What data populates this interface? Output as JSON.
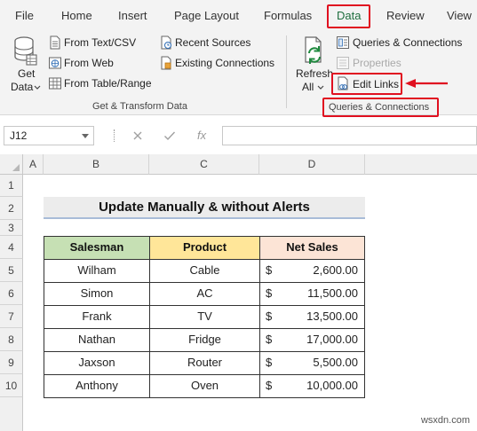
{
  "menu": {
    "tabs": [
      "File",
      "Home",
      "Insert",
      "Page Layout",
      "Formulas",
      "Data",
      "Review",
      "View"
    ],
    "active_tab": "Data"
  },
  "ribbon": {
    "get_data": {
      "line1": "Get",
      "line2": "Data"
    },
    "from_text_csv": "From Text/CSV",
    "from_web": "From Web",
    "from_table_range": "From Table/Range",
    "recent_sources": "Recent Sources",
    "existing_connections": "Existing Connections",
    "group1_label": "Get & Transform Data",
    "refresh": {
      "line1": "Refresh",
      "line2": "All"
    },
    "queries_connections": "Queries & Connections",
    "properties": "Properties",
    "edit_links": "Edit Links",
    "group2_label": "Queries & Connections"
  },
  "formula_bar": {
    "name_box": "J12",
    "fx": "fx",
    "formula": ""
  },
  "sheet": {
    "columns": [
      "A",
      "B",
      "C",
      "D"
    ],
    "rows": [
      "1",
      "2",
      "3",
      "4",
      "5",
      "6",
      "7",
      "8",
      "9",
      "10"
    ],
    "title": "Update Manually & without Alerts",
    "table_headers": [
      "Salesman",
      "Product",
      "Net Sales"
    ],
    "header_colors": [
      "#c6e0b4",
      "#ffe699",
      "#fce4d6"
    ],
    "currency_symbol": "$",
    "records": [
      {
        "salesman": "Wilham",
        "product": "Cable",
        "net_sales": "2,600.00"
      },
      {
        "salesman": "Simon",
        "product": "AC",
        "net_sales": "11,500.00"
      },
      {
        "salesman": "Frank",
        "product": "TV",
        "net_sales": "13,500.00"
      },
      {
        "salesman": "Nathan",
        "product": "Fridge",
        "net_sales": "17,000.00"
      },
      {
        "salesman": "Jaxson",
        "product": "Router",
        "net_sales": "5,500.00"
      },
      {
        "salesman": "Anthony",
        "product": "Oven",
        "net_sales": "10,000.00"
      }
    ]
  },
  "watermark": "wsxdn.com",
  "colors": {
    "excel_green": "#1e6e3e",
    "highlight_red": "#e01020"
  }
}
